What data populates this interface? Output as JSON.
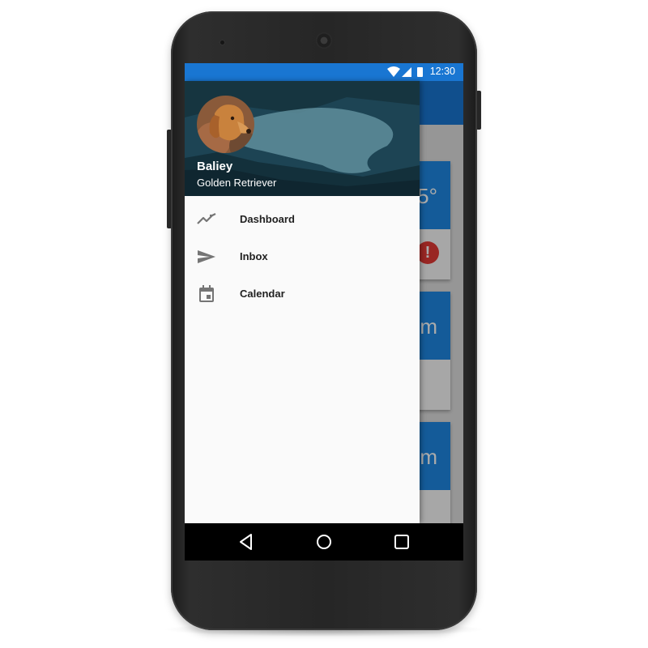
{
  "status_bar": {
    "time": "12:30",
    "icons": [
      "wifi-icon",
      "signal-icon",
      "battery-icon"
    ],
    "color": "#1976d2"
  },
  "background_app": {
    "toolbar_color": "#1976d2",
    "cards": [
      {
        "top_text": "5°",
        "has_alert": true
      },
      {
        "top_text": "m",
        "has_alert": false
      },
      {
        "top_text": "m",
        "has_alert": false
      }
    ]
  },
  "drawer": {
    "header": {
      "name": "Baliey",
      "subtitle": "Golden Retriever",
      "avatar_icon": "dog-avatar-icon"
    },
    "items": [
      {
        "label": "Dashboard",
        "icon": "trending-line-icon"
      },
      {
        "label": "Inbox",
        "icon": "send-icon"
      },
      {
        "label": "Calendar",
        "icon": "calendar-icon"
      }
    ]
  },
  "nav_bar": {
    "buttons": [
      "back-icon",
      "home-icon",
      "recents-icon"
    ]
  },
  "colors": {
    "accent": "#1e88e5",
    "alert": "#e53935",
    "drawer_bg": "#fafafa"
  }
}
